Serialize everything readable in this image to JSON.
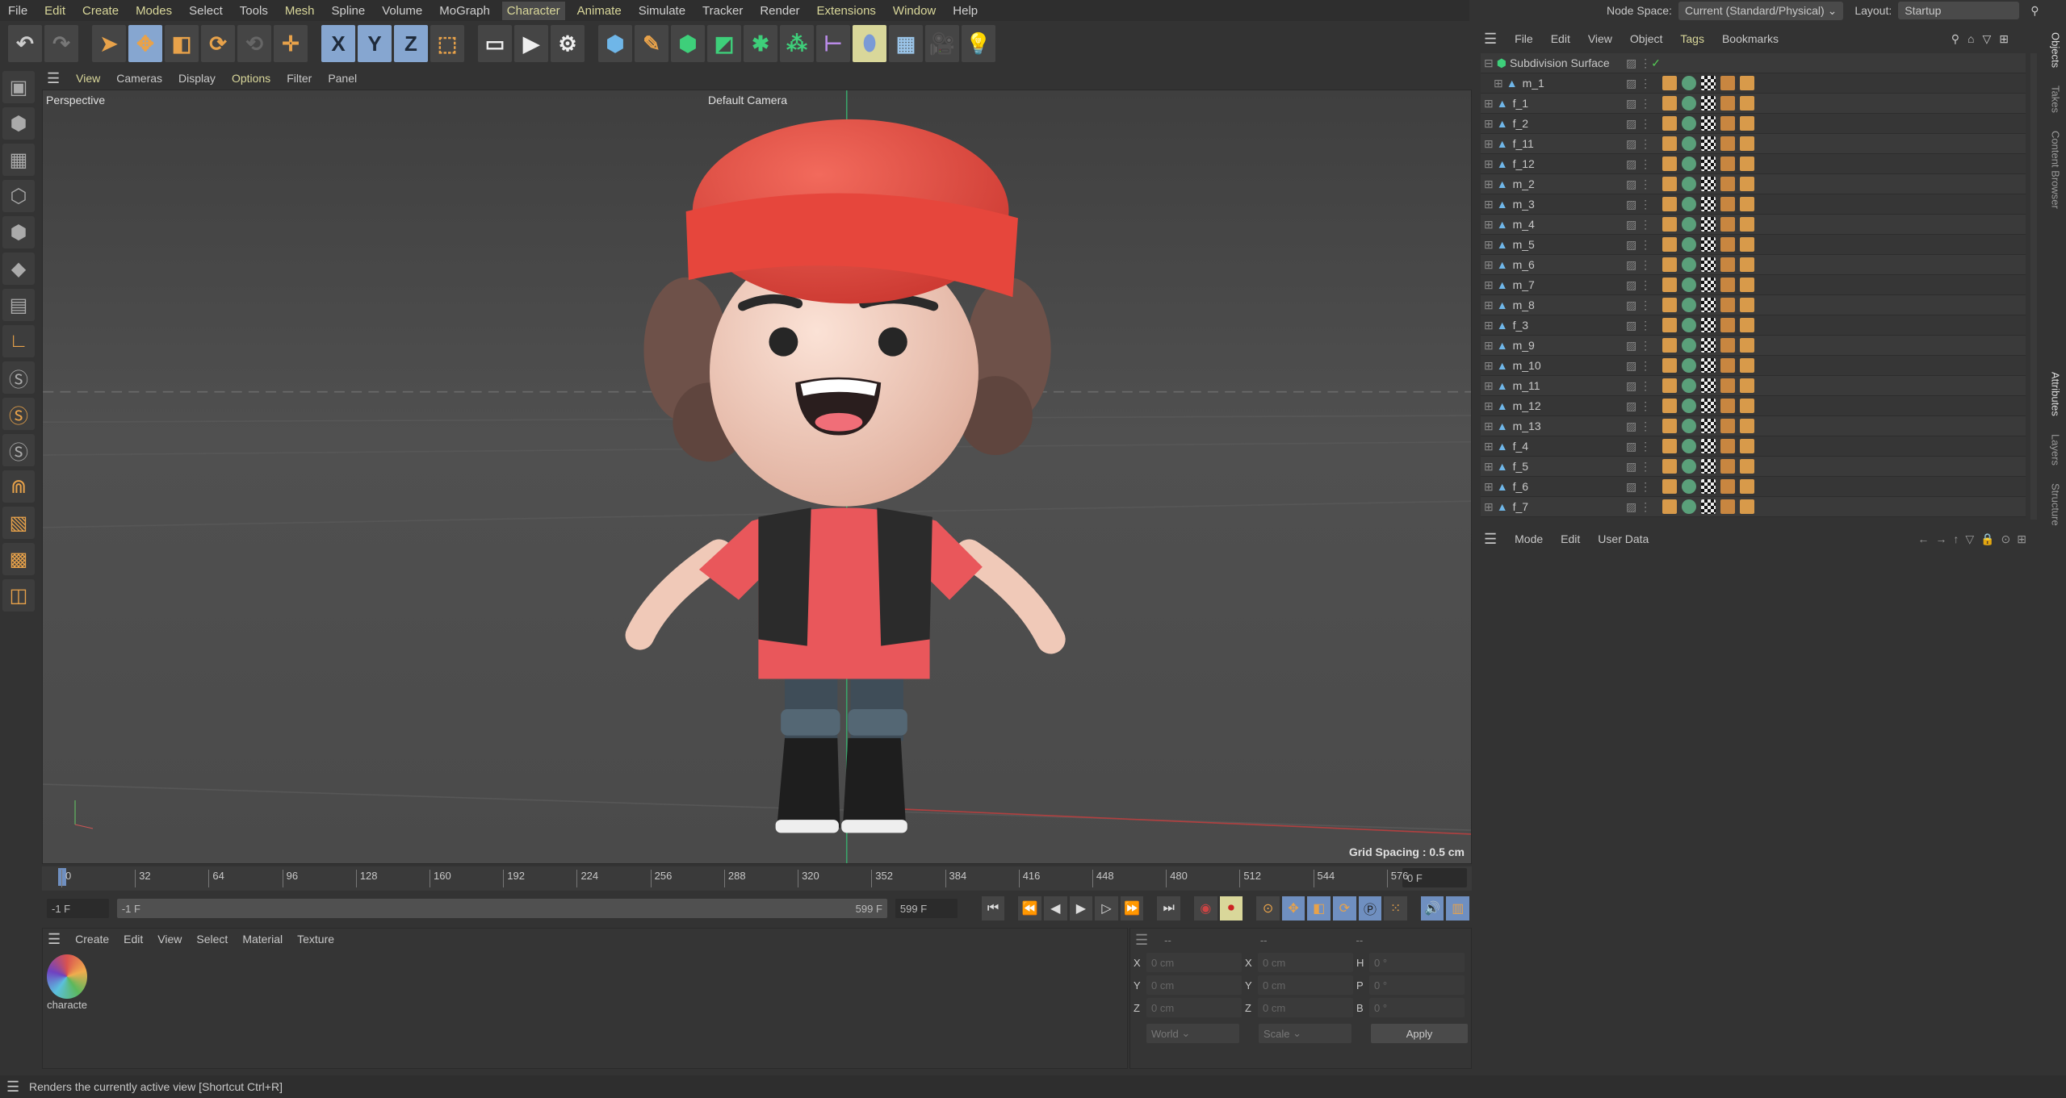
{
  "menu": [
    "File",
    "Edit",
    "Create",
    "Modes",
    "Select",
    "Tools",
    "Mesh",
    "Spline",
    "Volume",
    "MoGraph",
    "Character",
    "Animate",
    "Simulate",
    "Tracker",
    "Render",
    "Extensions",
    "Window",
    "Help"
  ],
  "menu_highlight": [
    "Edit",
    "Create",
    "Modes",
    "Mesh",
    "Animate",
    "Extensions",
    "Window"
  ],
  "menu_active": "Character",
  "toolbar": [
    {
      "name": "undo-icon",
      "g": "↶",
      "c": "#ccc"
    },
    {
      "name": "redo-icon",
      "g": "↷",
      "c": "#777"
    },
    {
      "name": "select-tool-icon",
      "g": "➤",
      "c": "#e8a24a",
      "gap": 1
    },
    {
      "name": "move-tool-icon",
      "g": "✥",
      "c": "#e8a24a",
      "sel": 1
    },
    {
      "name": "scale-tool-icon",
      "g": "◧",
      "c": "#e8a24a"
    },
    {
      "name": "rotate-tool-icon",
      "g": "⟳",
      "c": "#e8a24a"
    },
    {
      "name": "recent-tool-icon",
      "g": "⟲",
      "c": "#666"
    },
    {
      "name": "axis-move-icon",
      "g": "✛",
      "c": "#e8a24a"
    },
    {
      "name": "x-axis-lock-icon",
      "g": "X",
      "c": "#1e2a3a",
      "sel": 1,
      "gap": 1
    },
    {
      "name": "y-axis-lock-icon",
      "g": "Y",
      "c": "#1e2a3a",
      "sel": 1
    },
    {
      "name": "z-axis-lock-icon",
      "g": "Z",
      "c": "#1e2a3a",
      "sel": 1
    },
    {
      "name": "coordinate-system-icon",
      "g": "⬚",
      "c": "#e8a24a"
    },
    {
      "name": "render-view-icon",
      "g": "▭",
      "c": "#eee",
      "gap": 1
    },
    {
      "name": "render-picture-viewer-icon",
      "g": "▶",
      "c": "#eee"
    },
    {
      "name": "render-settings-icon",
      "g": "⚙",
      "c": "#eee"
    },
    {
      "name": "cube-icon",
      "g": "⬢",
      "c": "#6fb6e8",
      "gap": 1
    },
    {
      "name": "pen-icon",
      "g": "✎",
      "c": "#e8a24a"
    },
    {
      "name": "subdivision-icon",
      "g": "⬢",
      "c": "#3ecf7a"
    },
    {
      "name": "extrude-icon",
      "g": "◩",
      "c": "#3ecf7a"
    },
    {
      "name": "cloner-icon",
      "g": "✱",
      "c": "#3ecf7a"
    },
    {
      "name": "mograph-icon",
      "g": "⁂",
      "c": "#3ecf7a"
    },
    {
      "name": "deformer-icon",
      "g": "⊢",
      "c": "#b98be8"
    },
    {
      "name": "field-icon",
      "g": "⬮",
      "c": "#7a9ad6",
      "yel": 1
    },
    {
      "name": "floor-icon",
      "g": "▦",
      "c": "#9ac4e8"
    },
    {
      "name": "camera-icon",
      "g": "🎥",
      "c": "#eee"
    },
    {
      "name": "light-icon",
      "g": "💡",
      "c": "#eee"
    }
  ],
  "left_tools": [
    "model-mode-icon",
    "mesh-mode-icon",
    "texture-mode-icon",
    "points-mode-icon",
    "edges-mode-icon",
    "polygons-mode-icon",
    "uv-mode-icon",
    "axis-icon",
    "solo-off-icon",
    "solo-icon",
    "solo-hierarchy-icon",
    "snap-icon",
    "workplane-icon",
    "lock-workplane-icon",
    "planar-snap-icon"
  ],
  "viewport": {
    "menu": [
      "View",
      "Cameras",
      "Display",
      "Options",
      "Filter",
      "Panel"
    ],
    "label": "Perspective",
    "camera": "Default Camera",
    "grid": "Grid Spacing : 0.5 cm"
  },
  "top_right": {
    "node_space_label": "Node Space:",
    "node_space": "Current (Standard/Physical)",
    "layout_label": "Layout:",
    "layout": "Startup"
  },
  "object_manager": {
    "menu": [
      "File",
      "Edit",
      "View",
      "Object",
      "Tags",
      "Bookmarks"
    ],
    "root": "Subdivision Surface",
    "objects": [
      "m_1",
      "f_1",
      "f_2",
      "f_11",
      "f_12",
      "m_2",
      "m_3",
      "m_4",
      "m_5",
      "m_6",
      "m_7",
      "m_8",
      "f_3",
      "m_9",
      "m_10",
      "m_11",
      "m_12",
      "m_13",
      "f_4",
      "f_5",
      "f_6",
      "f_7"
    ]
  },
  "attributes": {
    "menu": [
      "Mode",
      "Edit",
      "User Data"
    ]
  },
  "side_tabs": [
    "Objects",
    "Takes",
    "Content Browser",
    "Attributes",
    "Layers",
    "Structure"
  ],
  "timeline": {
    "ticks": [
      "0",
      "32",
      "64",
      "96",
      "128",
      "160",
      "192",
      "224",
      "256",
      "288",
      "320",
      "352",
      "384",
      "416",
      "448",
      "480",
      "512",
      "544",
      "576"
    ],
    "current": "0 F",
    "start": "-1 F",
    "range_start": "-1 F",
    "range_end": "599 F",
    "end": "599 F"
  },
  "materials": {
    "menu": [
      "Create",
      "Edit",
      "View",
      "Select",
      "Material",
      "Texture"
    ],
    "items": [
      {
        "name": "characte"
      }
    ]
  },
  "coordinates": {
    "headers": [
      "--",
      "--",
      "--"
    ],
    "rows": [
      [
        "X",
        "0 cm",
        "X",
        "0 cm",
        "H",
        "0 °"
      ],
      [
        "Y",
        "0 cm",
        "Y",
        "0 cm",
        "P",
        "0 °"
      ],
      [
        "Z",
        "0 cm",
        "Z",
        "0 cm",
        "B",
        "0 °"
      ]
    ],
    "mode1": "World",
    "mode2": "Scale",
    "apply": "Apply"
  },
  "status": "Renders the currently active view [Shortcut Ctrl+R]"
}
